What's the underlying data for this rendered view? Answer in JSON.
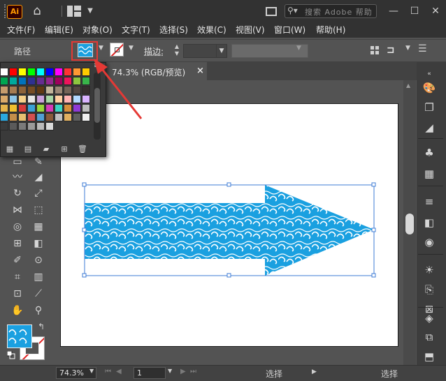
{
  "app": {
    "logo_text": "Ai",
    "search_placeholder": "搜索 Adobe 帮助"
  },
  "menu": [
    "文件(F)",
    "编辑(E)",
    "对象(O)",
    "文字(T)",
    "选择(S)",
    "效果(C)",
    "视图(V)",
    "窗口(W)",
    "帮助(H)"
  ],
  "control_bar": {
    "selection_label": "路径",
    "stroke_label": "描边",
    "stroke_colon": ":",
    "fill_color": "#1aa0e0"
  },
  "document": {
    "tab_title": "74.3% (RGB/预览)",
    "tab_close": "×"
  },
  "status_bar": {
    "zoom": "74.3%",
    "page": "1",
    "status_text": "选择",
    "status_text_right": "选择"
  },
  "icons": {
    "home": "home-icon",
    "search": "search-icon",
    "minimize": "minimize-icon",
    "maximize": "maximize-icon",
    "close": "close-icon"
  },
  "colors": {
    "accent_fill": "#1aa0e0",
    "highlight_box": "#e53935",
    "annotation_arrow": "#e53935"
  }
}
